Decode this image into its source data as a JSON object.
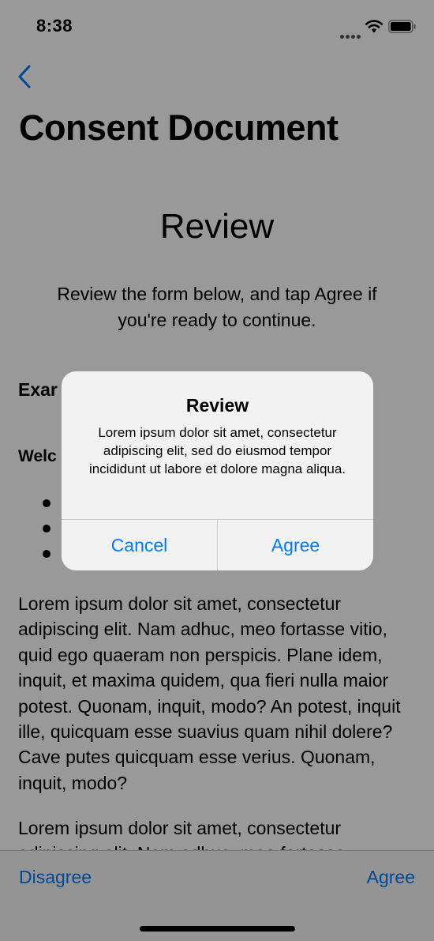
{
  "status_bar": {
    "time": "8:38"
  },
  "nav": {
    "back_icon": "chevron-left-icon",
    "title": "Consent Document"
  },
  "content": {
    "heading": "Review",
    "intro": "Review the form below, and tap Agree if you're ready to continue.",
    "doc_title_visible": "Exar",
    "doc_welcome_visible": "Welc",
    "paragraphs": [
      "Lorem ipsum dolor sit amet, consectetur adipiscing elit. Nam adhuc, meo fortasse vitio, quid ego quaeram non perspicis. Plane idem, inquit, et maxima quidem, qua fieri nulla maior potest. Quonam, inquit, modo? An potest, inquit ille, quicquam esse suavius quam nihil dolere? Cave putes quicquam esse verius. Quonam, inquit, modo?",
      "Lorem ipsum dolor sit amet, consectetur adipiscing elit. Nam adhuc, meo fortasse"
    ]
  },
  "toolbar": {
    "disagree_label": "Disagree",
    "agree_label": "Agree"
  },
  "alert": {
    "title": "Review",
    "message": "Lorem ipsum dolor sit amet, consectetur adipiscing elit, sed do eiusmod tempor incididunt ut labore et dolore magna aliqua.",
    "cancel_label": "Cancel",
    "agree_label": "Agree"
  },
  "colors": {
    "accent": "#007aff",
    "overlay": "rgba(0,0,0,0.4)"
  }
}
